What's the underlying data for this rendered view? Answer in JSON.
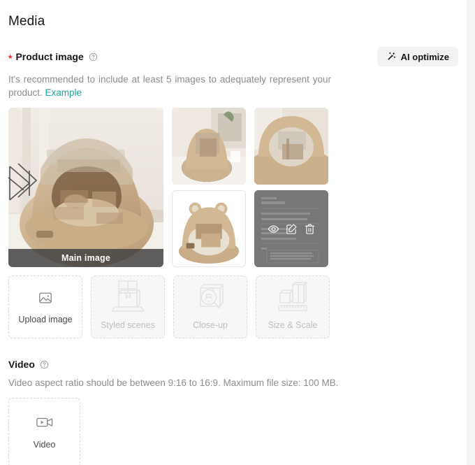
{
  "page": {
    "title": "Media"
  },
  "product_image": {
    "required_marker": "*",
    "label": "Product image",
    "help_icon": "question-circle-icon",
    "ai_button": {
      "label": "AI optimize",
      "icon": "magic-wand-icon"
    },
    "helper_text_prefix": "It's recommended to include at least 5 images to adequately represent your product. ",
    "example_link": "Example",
    "accent_link_color": "#19a79e",
    "required_color": "#f5222d",
    "tiles": [
      {
        "name": "main-image",
        "caption": "Main image",
        "selected": true,
        "overlay": false
      },
      {
        "name": "thumbnail-2",
        "caption": "",
        "overlay": false
      },
      {
        "name": "thumbnail-3",
        "caption": "",
        "overlay": false
      },
      {
        "name": "thumbnail-4",
        "caption": "",
        "overlay": false
      },
      {
        "name": "thumbnail-5",
        "caption": "",
        "overlay": true
      }
    ],
    "overlay_actions": [
      {
        "name": "preview",
        "icon": "eye-icon"
      },
      {
        "name": "edit",
        "icon": "edit-square-icon"
      },
      {
        "name": "delete",
        "icon": "trash-icon"
      }
    ],
    "placeholders": [
      {
        "label": "Upload image",
        "icon": "image-upload-icon",
        "disabled": false
      },
      {
        "label": "Styled scenes",
        "icon": "styled-scenes-icon",
        "disabled": true
      },
      {
        "label": "Close-up",
        "icon": "close-up-icon",
        "disabled": true
      },
      {
        "label": "Size & Scale",
        "icon": "size-scale-icon",
        "disabled": true
      }
    ]
  },
  "video": {
    "label": "Video",
    "help_icon": "question-circle-icon",
    "helper_text": "Video aspect ratio should be between 9:16 to 16:9. Maximum file size: 100 MB.",
    "upload_card": {
      "label": "Video",
      "icon": "video-camera-icon"
    }
  }
}
